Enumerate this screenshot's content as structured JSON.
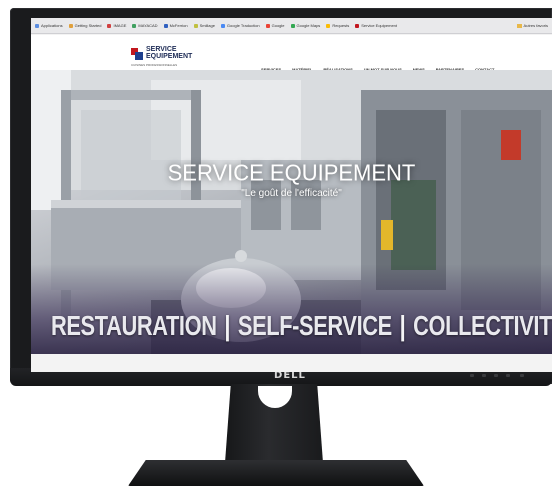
{
  "bookmarks": {
    "items": [
      "Applications",
      "Getting Started",
      "IMAGE",
      "MAYACAD",
      "McFerrion",
      "Smillage",
      "Google Traduction",
      "Google",
      "Google Maps",
      "Requests",
      "Service Equipement"
    ],
    "other_folder": "Autres favoris"
  },
  "site": {
    "logo_line1": "SERVICE",
    "logo_line2": "EQUIPEMENT",
    "logo_tagline": "CUISINES PROFESSIONNELLES",
    "nav": [
      "SERVICES",
      "MATÉRIEL",
      "RÉALISATIONS",
      "UN MOT SUR NOUS",
      "NEWS",
      "PARTENAIRES",
      "CONTACT"
    ]
  },
  "hero": {
    "title": "SERVICE EQUIPEMENT",
    "tagline": "\"Le goût de l'efficacité\"",
    "band_1": "RESTAURATION",
    "band_2": "SELF-SERVICE",
    "band_3": "COLLECTIVITÉS"
  },
  "monitor": {
    "brand": "DELL"
  },
  "colors": {
    "logo_red": "#c2171f",
    "logo_blue": "#1d3f8f",
    "bezel": "#1a1b1d"
  }
}
